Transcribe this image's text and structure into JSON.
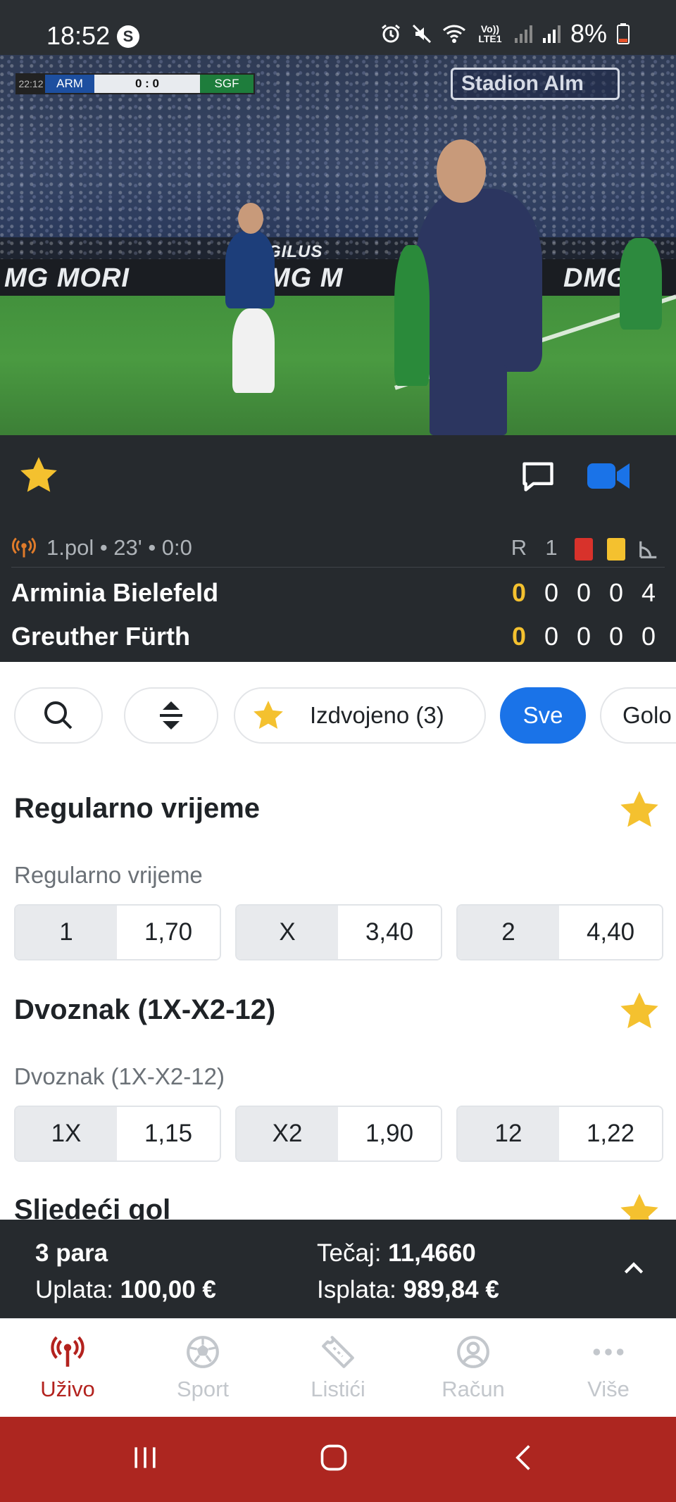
{
  "status_bar": {
    "time": "18:52",
    "app_badge": "S",
    "network": "Vo)) LTE1",
    "battery": "8%"
  },
  "video": {
    "scorebug": {
      "clock": "22:12",
      "home": "ARM",
      "score": "0 : 0",
      "away": "SGF"
    },
    "stadium_board": "Stadion Alm",
    "banner_1": "MG MORI",
    "banner_2": "MG M",
    "banner_3": "DMG",
    "signage": "GILUS"
  },
  "match_toolbar": {
    "favorite_icon": "star-icon",
    "chat_icon": "chat-icon",
    "video_icon": "video-camera-icon"
  },
  "match": {
    "status": "1.pol • 23' • 0:0",
    "columns": [
      "R",
      "1"
    ],
    "home": {
      "name": "Arminia Bielefeld",
      "score": "0",
      "stats": [
        "0",
        "0",
        "0",
        "4"
      ]
    },
    "away": {
      "name": "Greuther Fürth",
      "score": "0",
      "stats": [
        "0",
        "0",
        "0",
        "0"
      ]
    }
  },
  "filters": {
    "featured_label": "Izdvojeno (3)",
    "all_label": "Sve",
    "goals_label": "Golo"
  },
  "markets": [
    {
      "title": "Regularno vrijeme",
      "label": "Regularno vrijeme",
      "odds": [
        {
          "key": "1",
          "value": "1,70"
        },
        {
          "key": "X",
          "value": "3,40"
        },
        {
          "key": "2",
          "value": "4,40"
        }
      ]
    },
    {
      "title": "Dvoznak (1X-X2-12)",
      "label": "Dvoznak (1X-X2-12)",
      "odds": [
        {
          "key": "1X",
          "value": "1,15"
        },
        {
          "key": "X2",
          "value": "1,90"
        },
        {
          "key": "12",
          "value": "1,22"
        }
      ]
    },
    {
      "title": "Sljedeći gol"
    }
  ],
  "betslip": {
    "count": "3 para",
    "stake_label": "Uplata:",
    "stake_value": "100,00 €",
    "odds_label": "Tečaj:",
    "odds_value": "11,4660",
    "payout_label": "Isplata:",
    "payout_value": "989,84 €"
  },
  "bottom_nav": {
    "items": [
      {
        "label": "Uživo",
        "icon": "live-broadcast-icon",
        "active": true
      },
      {
        "label": "Sport",
        "icon": "soccer-ball-icon"
      },
      {
        "label": "Listići",
        "icon": "ticket-icon"
      },
      {
        "label": "Račun",
        "icon": "user-account-icon"
      },
      {
        "label": "Više",
        "icon": "more-dots-icon"
      }
    ]
  },
  "colors": {
    "accent_blue": "#1a73e8",
    "star_yellow": "#f4c12f",
    "active_red": "#b3221e",
    "dark_panel": "#262a2e"
  }
}
